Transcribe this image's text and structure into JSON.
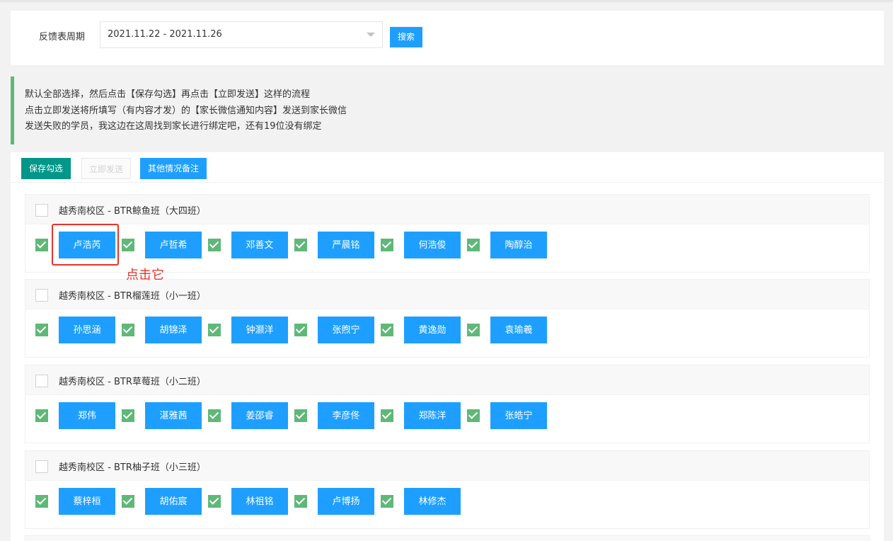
{
  "filter": {
    "label": "反馈表周期",
    "date_range": "2021.11.22 - 2021.11.26",
    "search_label": "搜索"
  },
  "notice": [
    "默认全部选择，然后点击【保存勾选】再点击【立即发送】这样的流程",
    "点击立即发送将所填写（有内容才发）的【家长微信通知内容】发送到家长微信",
    "发送失败的学员，我这边在这周找到家长进行绑定吧，还有19位没有绑定"
  ],
  "toolbar": {
    "save_label": "保存勾选",
    "send_label": "立即发送",
    "notes_label": "其他情况备注"
  },
  "groups": [
    {
      "title": "越秀南校区 - BTR鲸鱼班（大四班）",
      "students": [
        "卢浩芮",
        "卢哲希",
        "邓善文",
        "严晨铭",
        "何浩俊",
        "陶醇治"
      ]
    },
    {
      "title": "越秀南校区 - BTR榴莲班（小一班）",
      "students": [
        "孙思涵",
        "胡锦泽",
        "钟灏洋",
        "张煦宁",
        "黄逸勋",
        "袁瑜羲"
      ]
    },
    {
      "title": "越秀南校区 - BTR草莓班（小二班）",
      "students": [
        "郑伟",
        "湛雅茜",
        "姜邵睿",
        "李彦佟",
        "郑陈洋",
        "张皓宁"
      ]
    },
    {
      "title": "越秀南校区 - BTR柚子班（小三班）",
      "students": [
        "蔡梓桓",
        "胡佑宸",
        "林祖铭",
        "卢博扬",
        "林修杰"
      ]
    }
  ],
  "annotation": "点击它",
  "colors": {
    "primary": "#1e9fff",
    "save": "#009688",
    "check": "#5fb878",
    "annotation": "#e8332b"
  }
}
